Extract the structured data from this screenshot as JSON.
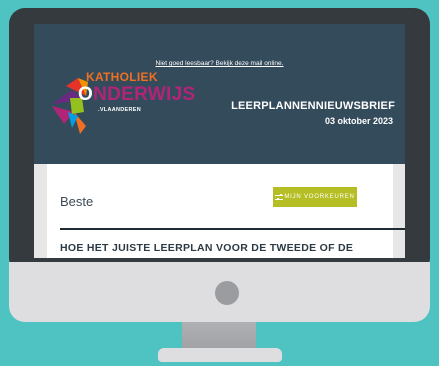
{
  "email": {
    "online_link": "Niet goed leesbaar? Bekijk deze mail online.",
    "logo": {
      "word1": "KATHOLIEK",
      "word2_first": "O",
      "word2_rest": "NDERWIJS",
      "word3": ".VLAANDEREN"
    },
    "newsletter_title": "LEERPLANNENNIEUWSBRIEF",
    "date": "03 oktober 2023",
    "greeting": "Beste",
    "preferences_button": "MIJN VOORKEUREN",
    "article_title": "HOE HET JUISTE LEERPLAN VOOR DE TWEEDE OF DE"
  },
  "colors": {
    "background": "#4fc3c2",
    "monitor_bezel": "#343a3e",
    "email_header": "#344b5c",
    "button": "#b5be24",
    "logo_orange": "#ef6f23",
    "logo_magenta": "#b12478"
  }
}
